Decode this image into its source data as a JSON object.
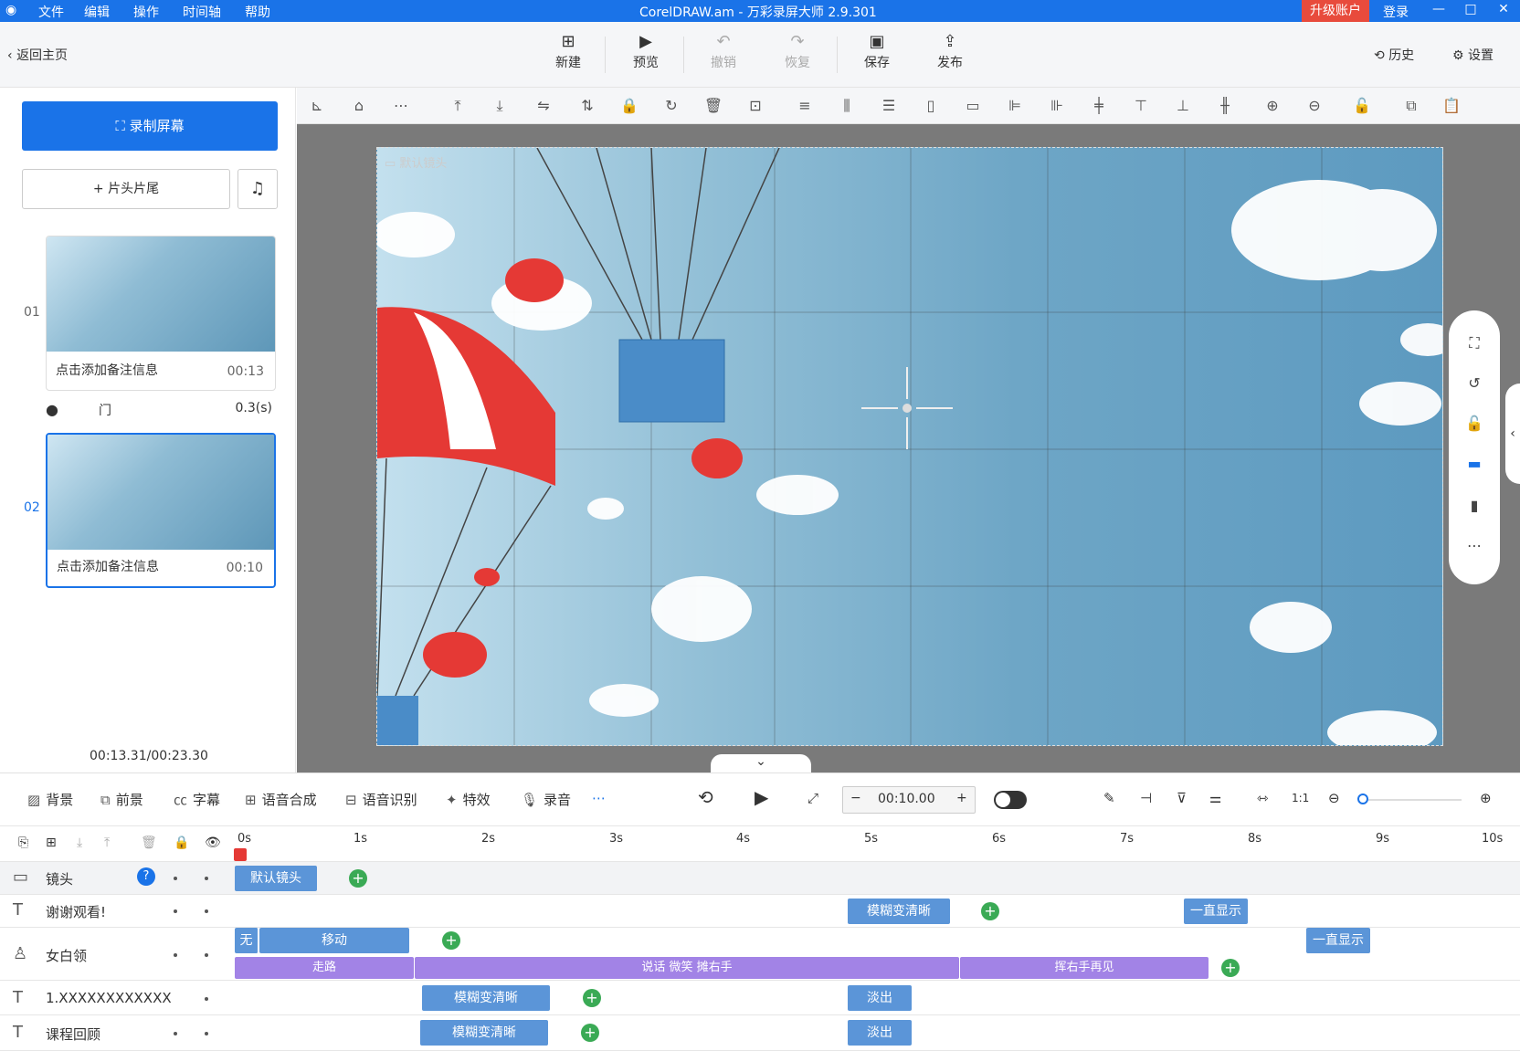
{
  "titlebar": {
    "menus": [
      "文件",
      "编辑",
      "操作",
      "时间轴",
      "帮助"
    ],
    "title": "CorelDRAW.am - 万彩录屏大师 2.9.301",
    "upgrade": "升级账户",
    "login": "登录"
  },
  "toolbar": {
    "back": "返回主页",
    "new": "新建",
    "preview": "预览",
    "undo": "撤销",
    "redo": "恢复",
    "save": "保存",
    "publish": "发布",
    "history": "历史",
    "settings": "设置"
  },
  "left": {
    "record": "录制屏幕",
    "headtail": "片头片尾",
    "clips": [
      {
        "num": "01",
        "note": "点击添加备注信息",
        "time": "00:13"
      },
      {
        "num": "02",
        "note": "点击添加备注信息",
        "time": "00:10"
      }
    ],
    "transition": {
      "name": "门",
      "duration": "0.3(s)"
    },
    "total_time": "00:13.31/00:23.30"
  },
  "stage": {
    "camera_label": "默认镜头"
  },
  "timeline_toolbar": {
    "items": [
      "背景",
      "前景",
      "字幕",
      "语音合成",
      "语音识别",
      "特效",
      "录音"
    ],
    "time_value": "00:10.00",
    "zoom_level": 0.02
  },
  "ruler": {
    "ticks": [
      "0s",
      "1s",
      "2s",
      "3s",
      "4s",
      "5s",
      "6s",
      "7s",
      "8s",
      "9s",
      "10s"
    ]
  },
  "tracks": [
    {
      "label": "镜头",
      "clips": [
        "默认镜头"
      ]
    },
    {
      "label": "谢谢观看!",
      "clips": [
        "模糊变清晰",
        "一直显示"
      ]
    },
    {
      "label": "女白领",
      "clips": [
        "无",
        "移动",
        "一直显示",
        "走路",
        "说话 微笑 摊右手",
        "挥右手再见"
      ]
    },
    {
      "label": "1.XXXXXXXXXXXX",
      "clips": [
        "模糊变清晰",
        "淡出"
      ]
    },
    {
      "label": "课程回顾",
      "clips": [
        "模糊变清晰",
        "淡出"
      ]
    }
  ],
  "colors": {
    "accent": "#1a73e8",
    "upgrade": "#e84b3c",
    "clip_blue": "#5b95d8",
    "clip_purple": "#a283e6",
    "keyframe": "#3aaa55"
  }
}
